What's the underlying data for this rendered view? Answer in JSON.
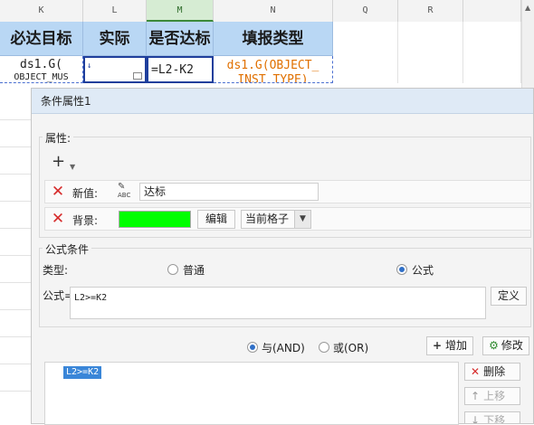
{
  "sheet": {
    "columns": [
      "K",
      "L",
      "M",
      "N",
      "Q",
      "R"
    ],
    "header_cells": [
      "必达目标",
      "实际",
      "是否达标",
      "填报类型"
    ],
    "data_cells": [
      "ds1.G(",
      "OBJECT_MUS",
      "=L2-K2",
      "ds1.G(OBJECT_",
      "INST_TYPE)"
    ]
  },
  "dialog": {
    "title": "条件属性1",
    "attributes_label": "属性:",
    "add_symbol": "+",
    "rows": [
      {
        "label": "新值:",
        "value": "达标"
      },
      {
        "label": "背景:",
        "edit_label": "编辑",
        "scope_value": "当前格子"
      }
    ],
    "formula_section_label": "公式条件",
    "type_label": "类型:",
    "type_options": [
      {
        "label": "普通",
        "checked": false
      },
      {
        "label": "公式",
        "checked": true
      }
    ],
    "formula_label": "公式=",
    "formula_value": "L2>=K2",
    "define_button": "定义",
    "logic_options": [
      {
        "label": "与(AND)",
        "checked": true
      },
      {
        "label": "或(OR)",
        "checked": false
      }
    ],
    "add_button": "增加",
    "modify_button": "修改",
    "delete_button": "删除",
    "move_up_button": "上移",
    "move_down_button": "下移",
    "condition_list": [
      "L2>=K2"
    ]
  },
  "colors": {
    "header_fill": "#b9d7f4",
    "background_swatch": "#00ff00",
    "formula_text": "#e07000",
    "selection": "#3a86d8"
  }
}
